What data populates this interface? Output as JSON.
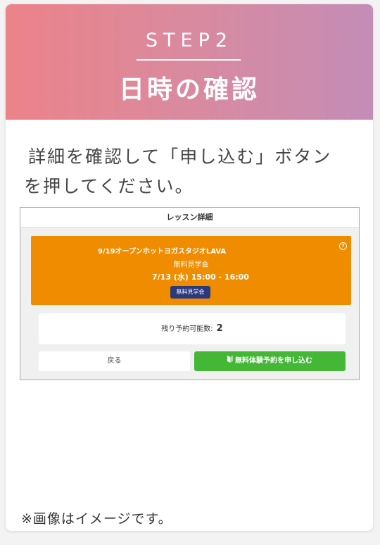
{
  "header": {
    "step_label": "STEP2",
    "title": "日時の確認"
  },
  "description": {
    "line1": "詳細を確認して「申し込む」ボタン",
    "line2": "を押してください。"
  },
  "screenshot": {
    "header_title": "レッスン詳細",
    "lesson": {
      "name": "9/19オープンホットヨガスタジオLAVA",
      "type": "無料見学会",
      "time": "7/13 (水)  15:00 - 16:00",
      "badge": "無料見学会",
      "help_icon": "question-circle-icon"
    },
    "remaining": {
      "label": "残り予約可能数:",
      "count": "2"
    },
    "back_button": "戻る",
    "apply_button": "無料体験予約を申し込む",
    "apply_icon": "beginner-mark-icon"
  },
  "note": "※画像はイメージです。",
  "colors": {
    "header_gradient_start": "#ec8389",
    "header_gradient_end": "#c48db6",
    "lesson_bg": "#ef8c00",
    "badge_bg": "#2c3a7d",
    "apply_bg": "#44b736"
  }
}
